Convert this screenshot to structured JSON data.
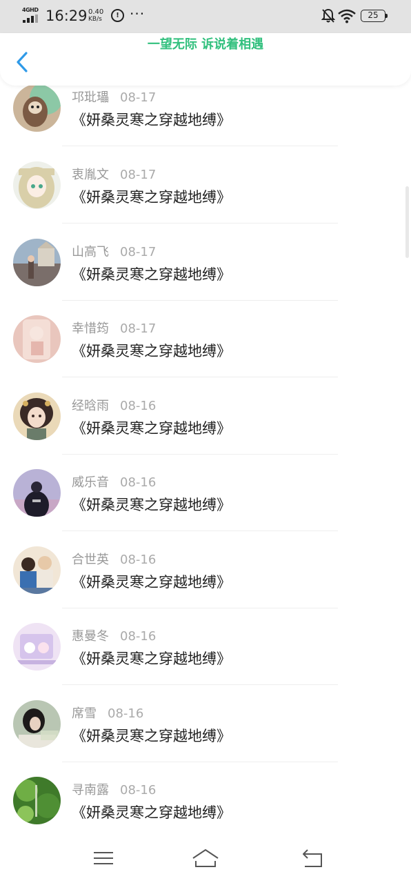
{
  "status_bar": {
    "network": "4GHD",
    "time": "16:29",
    "speed_value": "0.40",
    "speed_unit": "KB/s",
    "battery": "25"
  },
  "header": {
    "title": "一望无际 诉说着相遇",
    "title_color": "#32c07e",
    "back_icon": "chevron-left-icon",
    "accent": "#2f9ae8"
  },
  "items": [
    {
      "name": "邛玭瓃",
      "date": "08-17",
      "title": "《妍桑灵寒之穿越地缚》"
    },
    {
      "name": "衷胤文",
      "date": "08-17",
      "title": "《妍桑灵寒之穿越地缚》"
    },
    {
      "name": "山高飞",
      "date": "08-17",
      "title": "《妍桑灵寒之穿越地缚》"
    },
    {
      "name": "幸惜筠",
      "date": "08-17",
      "title": "《妍桑灵寒之穿越地缚》"
    },
    {
      "name": "经晗雨",
      "date": "08-16",
      "title": "《妍桑灵寒之穿越地缚》"
    },
    {
      "name": "威乐音",
      "date": "08-16",
      "title": "《妍桑灵寒之穿越地缚》"
    },
    {
      "name": "合世英",
      "date": "08-16",
      "title": "《妍桑灵寒之穿越地缚》"
    },
    {
      "name": "惠曼冬",
      "date": "08-16",
      "title": "《妍桑灵寒之穿越地缚》"
    },
    {
      "name": "席雪",
      "date": "08-16",
      "title": "《妍桑灵寒之穿越地缚》"
    },
    {
      "name": "寻南露",
      "date": "08-16",
      "title": "《妍桑灵寒之穿越地缚》"
    }
  ],
  "nav": {
    "menu_icon": "menu-icon",
    "home_icon": "home-icon",
    "back_icon": "back-arrow-icon"
  }
}
